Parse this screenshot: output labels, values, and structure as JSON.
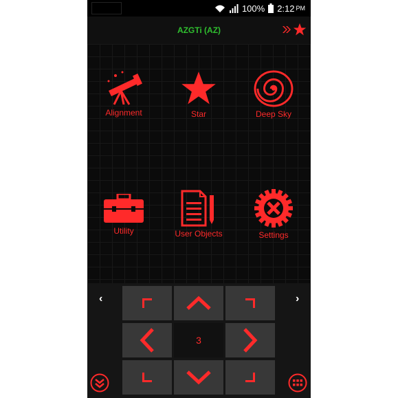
{
  "status": {
    "battery_percent": "100%",
    "time": "2:12",
    "ampm": "PM"
  },
  "header": {
    "title": "AZGTi (AZ)"
  },
  "menu": {
    "alignment": "Alignment",
    "star": "Star",
    "deep_sky": "Deep Sky",
    "utility": "Utility",
    "user_objects": "User Objects",
    "settings": "Settings"
  },
  "pad": {
    "rate": "3",
    "prev": "‹",
    "next": "›"
  },
  "colors": {
    "accent": "#ff2a2a",
    "title": "#2fbf2f",
    "button": "#383838",
    "background": "#0b0b0b"
  }
}
